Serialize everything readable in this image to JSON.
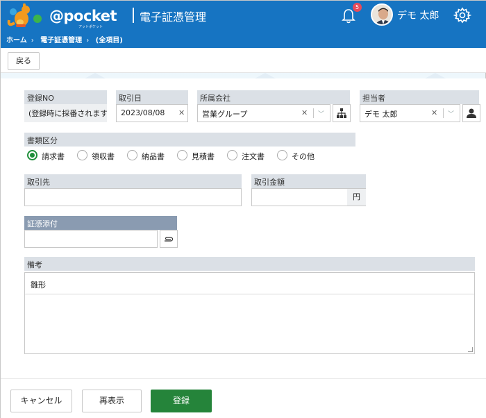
{
  "header": {
    "logo_text": "@pocket",
    "logo_sub": "アットポケット",
    "app_title": "電子証憑管理",
    "notification_count": "5",
    "user_name": "デモ 太郎",
    "brand_color": "#1674c2"
  },
  "breadcrumb": [
    "ホーム",
    "電子証憑管理",
    "(全項目)"
  ],
  "toolbar": {
    "back_label": "戻る"
  },
  "form": {
    "reg_no": {
      "label": "登録NO",
      "value": "(登録時に採番されます"
    },
    "trade_date": {
      "label": "取引日",
      "value": "2023/08/08"
    },
    "company": {
      "label": "所属会社",
      "value": "営業グループ"
    },
    "person": {
      "label": "担当者",
      "value": "デモ 太郎"
    },
    "doc_type": {
      "label": "書類区分",
      "options": [
        "請求書",
        "領収書",
        "納品書",
        "見積書",
        "注文書",
        "その他"
      ],
      "selected": "請求書"
    },
    "client": {
      "label": "取引先",
      "value": ""
    },
    "amount": {
      "label": "取引金額",
      "value": "",
      "suffix": "円"
    },
    "attachment": {
      "label": "証憑添付",
      "value": ""
    },
    "note": {
      "label": "備考",
      "value": "雛形"
    }
  },
  "footer": {
    "cancel_label": "キャンセル",
    "refresh_label": "再表示",
    "submit_label": "登録",
    "submit_color": "#25843a"
  }
}
